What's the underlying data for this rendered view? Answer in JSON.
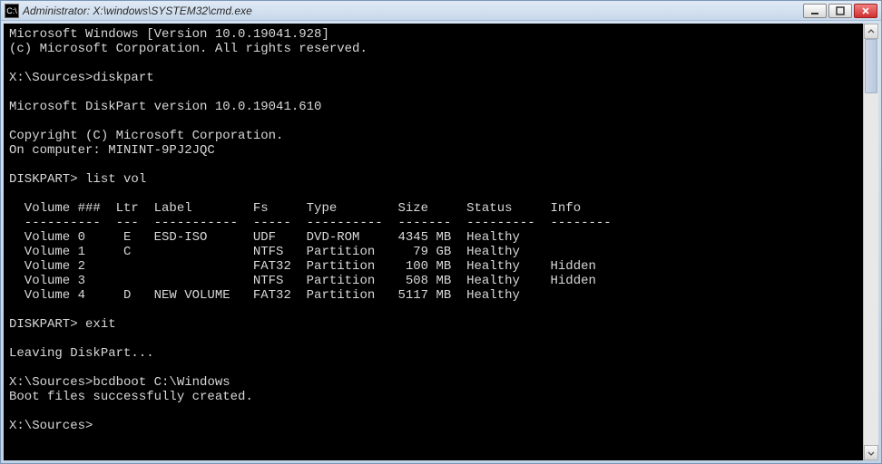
{
  "window": {
    "title": "Administrator: X:\\windows\\SYSTEM32\\cmd.exe",
    "icon_text": "C:\\"
  },
  "header": {
    "line1": "Microsoft Windows [Version 10.0.19041.928]",
    "line2": "(c) Microsoft Corporation. All rights reserved."
  },
  "prompt1": {
    "prefix": "X:\\Sources>",
    "cmd": "diskpart"
  },
  "diskpart": {
    "version": "Microsoft DiskPart version 10.0.19041.610",
    "copyright": "Copyright (C) Microsoft Corporation.",
    "computer": "On computer: MININT-9PJ2JQC"
  },
  "dp1": {
    "prefix": "DISKPART> ",
    "cmd": "list vol"
  },
  "vol": {
    "header": "  Volume ###  Ltr  Label        Fs     Type        Size     Status     Info",
    "sep": "  ----------  ---  -----------  -----  ----------  -------  ---------  --------",
    "r0": "  Volume 0     E   ESD-ISO      UDF    DVD-ROM     4345 MB  Healthy",
    "r1": "  Volume 1     C                NTFS   Partition     79 GB  Healthy",
    "r2": "  Volume 2                      FAT32  Partition    100 MB  Healthy    Hidden",
    "r3": "  Volume 3                      NTFS   Partition    508 MB  Healthy    Hidden",
    "r4": "  Volume 4     D   NEW VOLUME   FAT32  Partition   5117 MB  Healthy"
  },
  "dp2": {
    "prefix": "DISKPART> ",
    "cmd": "exit"
  },
  "leaving": "Leaving DiskPart...",
  "prompt2": {
    "prefix": "X:\\Sources>",
    "cmd": "bcdboot C:\\Windows"
  },
  "bootmsg": "Boot files successfully created.",
  "prompt3": {
    "prefix": "X:\\Sources>",
    "cmd": ""
  }
}
